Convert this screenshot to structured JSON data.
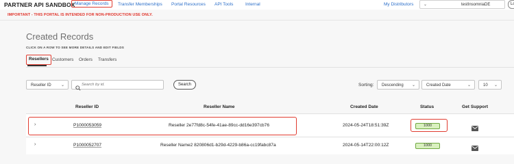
{
  "header": {
    "brand": "PARTNER API SANDBOX",
    "nav": [
      "Manage Records",
      "Transfer Memberships",
      "Portal Resources",
      "API Tools",
      "Internal"
    ],
    "distributors": "My Distributors",
    "tenant_value": "testInsomniaDE",
    "logout": "Lo"
  },
  "warning": "IMPORTANT - THIS PORTAL IS INTENDED FOR NON-PRODUCTION USE ONLY.",
  "page": {
    "title": "Created Records",
    "subtitle": "CLICK ON A ROW TO SEE MORE DETAILS AND EDIT FIELDS"
  },
  "tabs": [
    "Resellers",
    "Customers",
    "Orders",
    "Transfers"
  ],
  "filters": {
    "field_select": "Reseller ID",
    "search_placeholder": "Search by id.",
    "search_button": "Search",
    "sorting_label": "Sorting:",
    "sort_order": "Descending",
    "sort_field": "Created Date",
    "page_size": "10"
  },
  "table": {
    "columns": [
      "Reseller ID",
      "Reseller Name",
      "Created Date",
      "Status",
      "Get Support"
    ],
    "rows": [
      {
        "id": "P1000053059",
        "name": "Reseller 2e77fd8c-54fe-41ae-89cc-dd16e397cb76",
        "created": "2024-05-24T18:51:39Z",
        "status": "1000"
      },
      {
        "id": "P1000052707",
        "name": "Reseller Name2 820806d1-b29d-4229-b86a-cc19fabc87a",
        "created": "2024-05-14T22:00:12Z",
        "status": "1000"
      }
    ]
  },
  "colors": {
    "link": "#2c6fc9",
    "warning": "#e0332a",
    "highlight": "#e03a2e",
    "status_bg": "#d9f0c0",
    "status_border": "#6fa840"
  }
}
